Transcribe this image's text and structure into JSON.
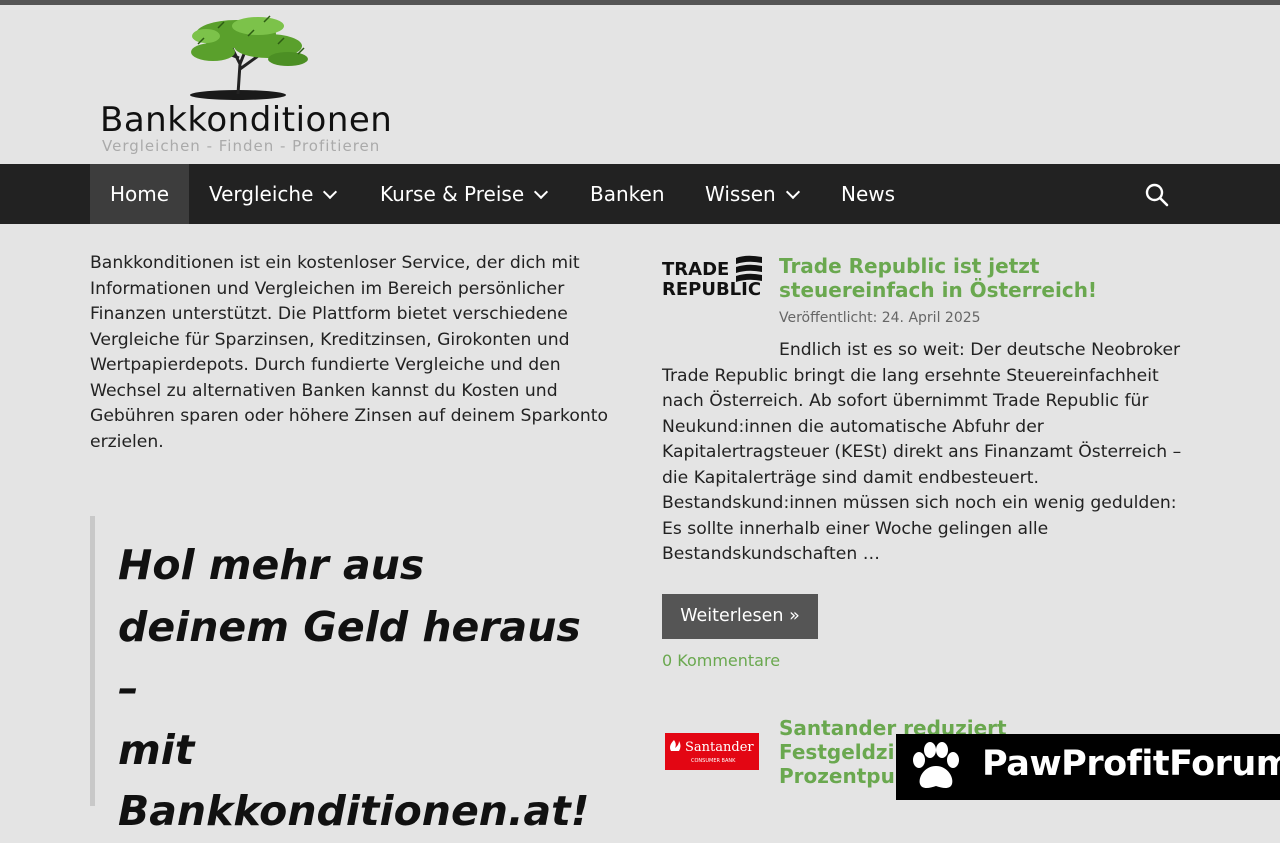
{
  "site": {
    "title": "Bankkonditionen",
    "tagline": "Vergleichen - Finden - Profitieren"
  },
  "nav": {
    "items": [
      {
        "label": "Home",
        "active": true,
        "has_dropdown": false
      },
      {
        "label": "Vergleiche",
        "active": false,
        "has_dropdown": true
      },
      {
        "label": "Kurse & Preise",
        "active": false,
        "has_dropdown": true
      },
      {
        "label": "Banken",
        "active": false,
        "has_dropdown": false
      },
      {
        "label": "Wissen",
        "active": false,
        "has_dropdown": true
      },
      {
        "label": "News",
        "active": false,
        "has_dropdown": false
      }
    ],
    "search_icon": "search-icon"
  },
  "intro": {
    "text": "Bankkonditionen ist ein kostenloser Service, der dich mit Informationen und Vergleichen im Bereich persönlicher Finanzen unterstützt. Die Plattform bietet verschiedene Vergleiche für Sparzinsen, Kreditzinsen, Girokonten und Wertpapierdepots. Durch fundierte Vergleiche und den Wechsel zu alternativen Banken kannst du Kosten und Gebühren sparen oder höhere Zinsen auf deinem Sparkonto erzielen."
  },
  "quote": {
    "lines": [
      "Hol mehr aus",
      "deinem Geld heraus",
      "–",
      "mit",
      "Bankkonditionen.at!"
    ]
  },
  "posts": [
    {
      "logo_text_1": "TRADE",
      "logo_text_2": "REPUBLIC",
      "title_line_1": "Trade Republic ist jetzt",
      "title_line_2": "steuereinfach in Österreich!",
      "date": "Veröffentlicht: 24. April 2025",
      "excerpt": "Endlich ist es so weit: Der deutsche Neobroker Trade Republic bringt die lang ersehnte Steuereinfachheit nach Österreich. Ab sofort übernimmt Trade Republic für Neukund:innen die automatische Abfuhr der Kapitalertragsteuer (KESt) direkt ans Finanzamt Österreich – die Kapitalerträge sind damit endbesteuert. Bestandskund:innen müssen sich noch ein wenig gedulden: Es sollte innerhalb einer Woche gelingen alle Bestandskundschaften …",
      "read_more": "Weiterlesen »",
      "comments": "0 Kommentare"
    },
    {
      "logo_text_1": "Santander",
      "logo_text_2": "CONSUMER BANK",
      "title_line_1": "Santander reduziert",
      "title_line_2": "Festgeldzi",
      "title_line_3": "Prozentpu"
    }
  ],
  "badge": {
    "text": "PawProfitForum"
  },
  "colors": {
    "accent_green": "#6aa84f",
    "nav_bg": "#222222",
    "santander_red": "#e30613"
  }
}
